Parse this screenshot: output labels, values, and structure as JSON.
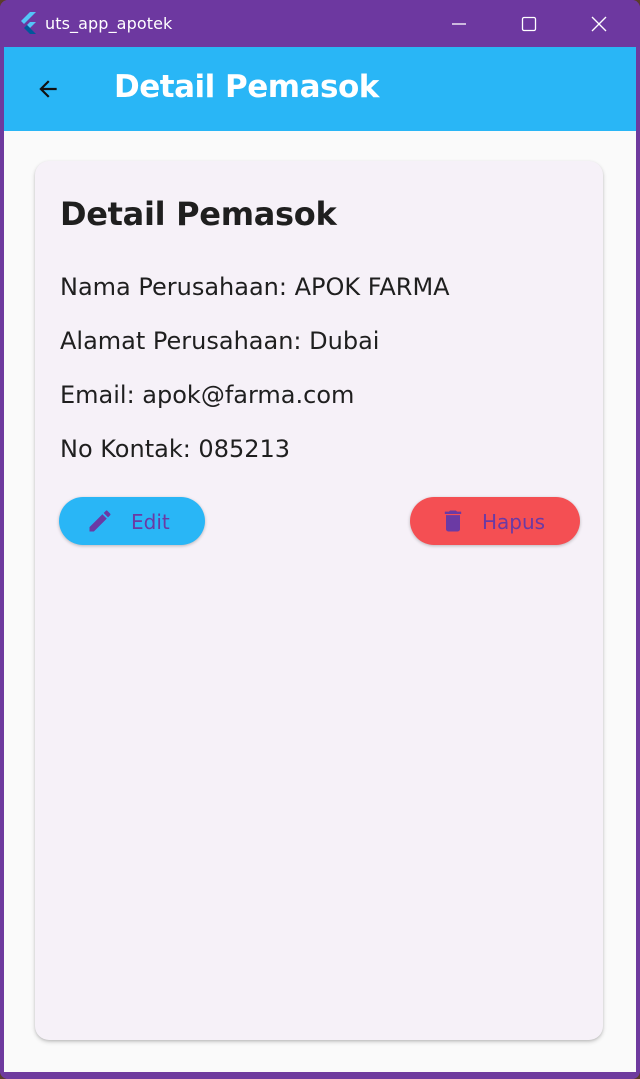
{
  "window": {
    "title": "uts_app_apotek",
    "controls": [
      "minimize-icon",
      "maximize-icon",
      "close-icon"
    ]
  },
  "appbar": {
    "back_icon": "arrow-left-icon",
    "title": "Detail Pemasok"
  },
  "card": {
    "title": "Detail Pemasok",
    "fields": [
      "Nama Perusahaan: APOK FARMA",
      "Alamat Perusahaan: Dubai",
      "Email: apok@farma.com",
      "No Kontak: 085213"
    ],
    "buttons": {
      "edit": {
        "label": "Edit",
        "icon": "pencil-icon"
      },
      "delete": {
        "label": "Hapus",
        "icon": "trash-icon"
      }
    }
  },
  "colors": {
    "titlebar": "#6d38a0",
    "appbar": "#29b6f6",
    "card_bg": "#f6f1f8",
    "edit_button": "#29b6f6",
    "delete_button": "#f44f53",
    "button_text": "#6b3aa4"
  }
}
